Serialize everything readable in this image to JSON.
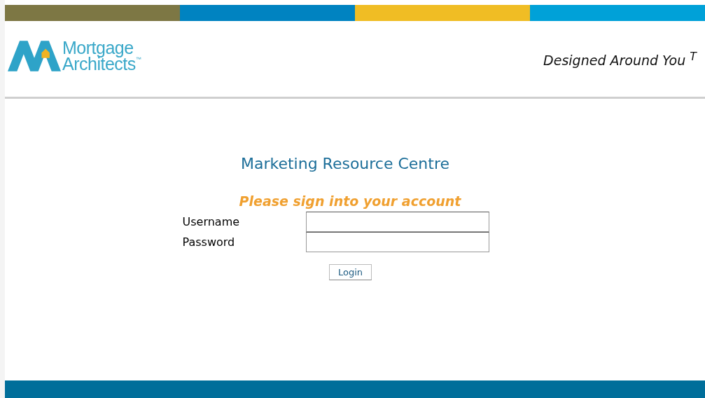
{
  "header": {
    "logo_lines": [
      "Mortgage",
      "Architects"
    ],
    "logo_mark": "™",
    "tagline": "Designed Around You $^{T}$"
  },
  "login": {
    "title": "Marketing Resource Centre",
    "prompt": "Please sign into your account",
    "fields": [
      {
        "label": "Username"
      },
      {
        "label": "Password"
      }
    ],
    "button": "Login"
  }
}
